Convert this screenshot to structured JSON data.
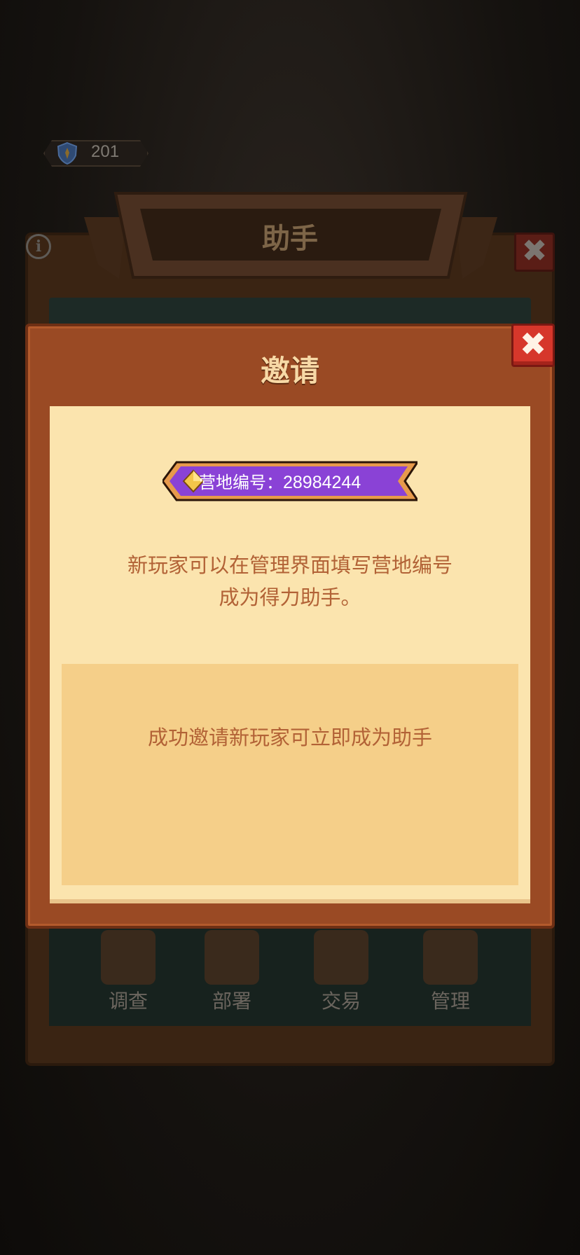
{
  "hud": {
    "shield_value": "201",
    "icon": "shield-icon"
  },
  "background_panel": {
    "title": "助手",
    "info_icon": "i",
    "close_icon": "✖",
    "tools": [
      {
        "label": "调查",
        "icon": "magnifier-clipboard-icon"
      },
      {
        "label": "部署",
        "icon": "map-pin-icon"
      },
      {
        "label": "交易",
        "icon": "trade-cart-icon"
      },
      {
        "label": "管理",
        "icon": "gear-icon"
      }
    ]
  },
  "modal": {
    "title": "邀请",
    "close_icon": "✖",
    "camp_id_label": "营地编号：",
    "camp_id_value": "28984244",
    "description_line1": "新玩家可以在管理界面填写营地编号",
    "description_line2": "成为得力助手。",
    "notice": "成功邀请新玩家可立即成为助手"
  },
  "colors": {
    "modal_frame": "#9a4a24",
    "content_bg": "#fbe4ae",
    "notice_bg": "#f5cf89",
    "text_brown": "#b26236",
    "badge_purple": "#8a42d6",
    "close_red": "#d6372b"
  }
}
